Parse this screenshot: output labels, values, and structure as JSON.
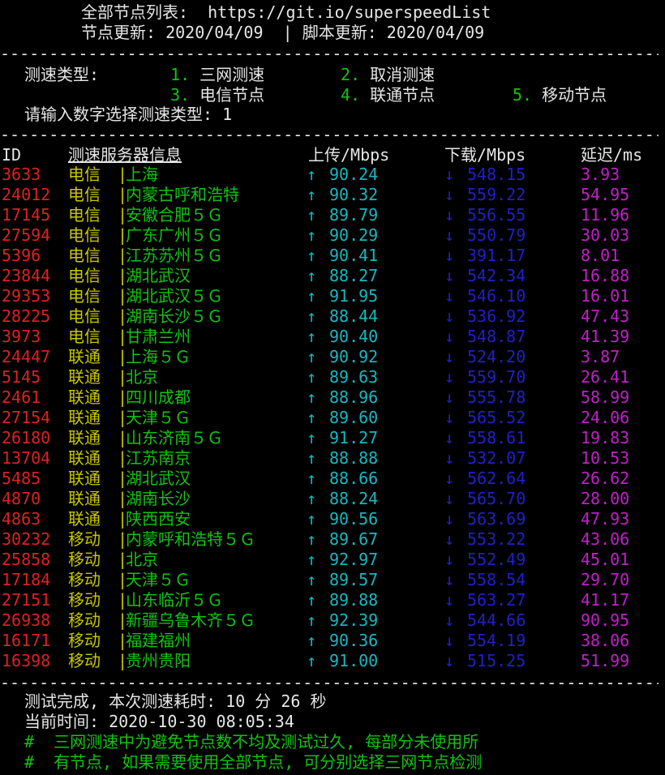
{
  "header": {
    "list_label": "全部节点列表:",
    "list_url": "https://git.io/superspeedList",
    "node_update_label": "节点更新:",
    "node_update": "2020/04/09",
    "divider": "|",
    "script_update_label": "脚本更新:",
    "script_update": "2020/04/09"
  },
  "separator": "----------------------------------------------------------------------",
  "menu": {
    "type_label": "测速类型:",
    "options": [
      {
        "num": "1.",
        "label": "三网测速"
      },
      {
        "num": "2.",
        "label": "取消测速"
      },
      {
        "num": "3.",
        "label": "电信节点"
      },
      {
        "num": "4.",
        "label": "联通节点"
      },
      {
        "num": "5.",
        "label": "移动节点"
      }
    ],
    "prompt": "请输入数字选择测速类型: 1"
  },
  "table": {
    "headers": {
      "id": "ID",
      "server": "测速服务器信息",
      "upload": "上传/Mbps",
      "download": "下载/Mbps",
      "latency": "延迟/ms"
    },
    "rows": [
      {
        "id": "3633",
        "isp": "电信",
        "loc": "上海",
        "up": "90.24",
        "down": "548.15",
        "lat": "3.93"
      },
      {
        "id": "24012",
        "isp": "电信",
        "loc": "内蒙古呼和浩特",
        "up": "90.32",
        "down": "559.22",
        "lat": "54.95"
      },
      {
        "id": "17145",
        "isp": "电信",
        "loc": "安徽合肥５Ｇ",
        "up": "89.79",
        "down": "556.55",
        "lat": "11.96"
      },
      {
        "id": "27594",
        "isp": "电信",
        "loc": "广东广州５Ｇ",
        "up": "90.29",
        "down": "550.79",
        "lat": "30.03"
      },
      {
        "id": "5396",
        "isp": "电信",
        "loc": "江苏苏州５Ｇ",
        "up": "90.41",
        "down": "391.17",
        "lat": "8.01"
      },
      {
        "id": "23844",
        "isp": "电信",
        "loc": "湖北武汉",
        "up": "88.27",
        "down": "542.34",
        "lat": "16.88"
      },
      {
        "id": "29353",
        "isp": "电信",
        "loc": "湖北武汉５Ｇ",
        "up": "91.95",
        "down": "546.10",
        "lat": "16.01"
      },
      {
        "id": "28225",
        "isp": "电信",
        "loc": "湖南长沙５Ｇ",
        "up": "88.44",
        "down": "536.92",
        "lat": "47.43"
      },
      {
        "id": "3973",
        "isp": "电信",
        "loc": "甘肃兰州",
        "up": "90.40",
        "down": "548.87",
        "lat": "41.39"
      },
      {
        "id": "24447",
        "isp": "联通",
        "loc": "上海５Ｇ",
        "up": "90.92",
        "down": "524.20",
        "lat": "3.87"
      },
      {
        "id": "5145",
        "isp": "联通",
        "loc": "北京",
        "up": "89.63",
        "down": "559.70",
        "lat": "26.41"
      },
      {
        "id": "2461",
        "isp": "联通",
        "loc": "四川成都",
        "up": "88.96",
        "down": "555.78",
        "lat": "58.99"
      },
      {
        "id": "27154",
        "isp": "联通",
        "loc": "天津５Ｇ",
        "up": "89.60",
        "down": "565.52",
        "lat": "24.06"
      },
      {
        "id": "26180",
        "isp": "联通",
        "loc": "山东济南５Ｇ",
        "up": "91.27",
        "down": "558.61",
        "lat": "19.83"
      },
      {
        "id": "13704",
        "isp": "联通",
        "loc": "江苏南京",
        "up": "88.88",
        "down": "532.07",
        "lat": "10.53"
      },
      {
        "id": "5485",
        "isp": "联通",
        "loc": "湖北武汉",
        "up": "88.66",
        "down": "562.64",
        "lat": "26.62"
      },
      {
        "id": "4870",
        "isp": "联通",
        "loc": "湖南长沙",
        "up": "88.24",
        "down": "565.70",
        "lat": "28.00"
      },
      {
        "id": "4863",
        "isp": "联通",
        "loc": "陕西西安",
        "up": "90.56",
        "down": "563.69",
        "lat": "47.93"
      },
      {
        "id": "30232",
        "isp": "移动",
        "loc": "内蒙呼和浩特５Ｇ",
        "up": "89.67",
        "down": "553.22",
        "lat": "43.06"
      },
      {
        "id": "25858",
        "isp": "移动",
        "loc": "北京",
        "up": "92.97",
        "down": "552.49",
        "lat": "45.01"
      },
      {
        "id": "17184",
        "isp": "移动",
        "loc": "天津５Ｇ",
        "up": "89.57",
        "down": "558.54",
        "lat": "29.70"
      },
      {
        "id": "27151",
        "isp": "移动",
        "loc": "山东临沂５Ｇ",
        "up": "89.88",
        "down": "563.27",
        "lat": "41.17"
      },
      {
        "id": "26938",
        "isp": "移动",
        "loc": "新疆乌鲁木齐５Ｇ",
        "up": "92.39",
        "down": "544.66",
        "lat": "90.95"
      },
      {
        "id": "16171",
        "isp": "移动",
        "loc": "福建福州",
        "up": "90.36",
        "down": "554.19",
        "lat": "38.06"
      },
      {
        "id": "16398",
        "isp": "移动",
        "loc": "贵州贵阳",
        "up": "91.00",
        "down": "515.25",
        "lat": "51.99"
      }
    ],
    "up_arrow": "↑",
    "down_arrow": "↓",
    "separator_bar": "|"
  },
  "footer": {
    "done": "测试完成, 本次测速耗时: 10 分 26 秒",
    "time": "当前时间: 2020-10-30 08:05:34",
    "notes": [
      "#  三网测速中为避免节点数不均及测试过久, 每部分未使用所",
      "#  有节点, 如果需要使用全部节点, 可分别选择三网节点检测"
    ]
  },
  "colors": {
    "background": "#000000",
    "text": "#e6e6e6",
    "green": "#12c312",
    "id_red": "#e02020",
    "isp_yellow": "#c8c800",
    "upload_cyan": "#16b8c0",
    "download_blue": "#2020c8",
    "latency_magenta": "#c020c8"
  }
}
